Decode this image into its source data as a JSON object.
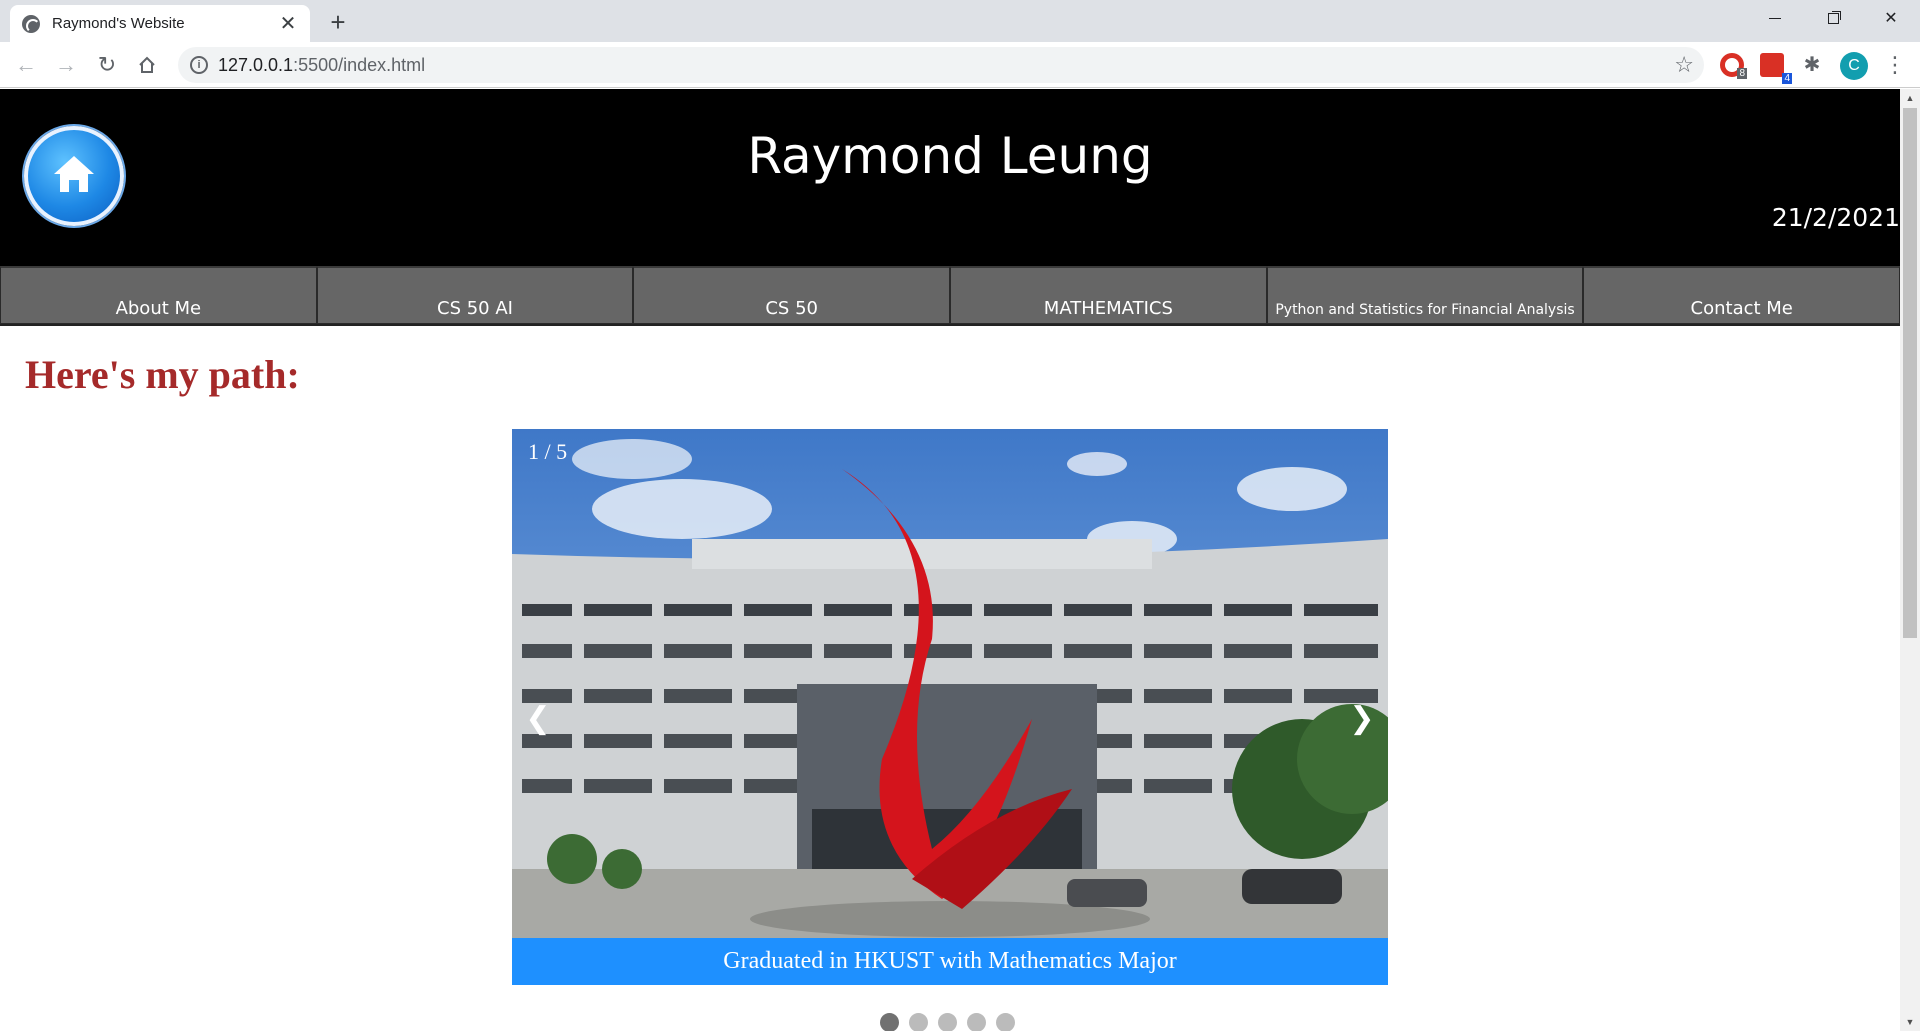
{
  "browser": {
    "tab_title": "Raymond's Website",
    "tab_close": "✕",
    "new_tab": "+",
    "url_host": "127.0.0.1",
    "url_rest": ":5500/index.html",
    "ext1_badge": "8",
    "ext2_badge": "4",
    "avatar_letter": "C"
  },
  "header": {
    "title": "Raymond Leung",
    "date": "21/2/2021"
  },
  "nav": {
    "items": [
      {
        "label": "About Me"
      },
      {
        "label": "CS 50 AI"
      },
      {
        "label": "CS 50"
      },
      {
        "label": "MATHEMATICS"
      },
      {
        "label": "Python and Statistics for Financial Analysis"
      },
      {
        "label": "Contact Me"
      }
    ]
  },
  "main": {
    "heading": "Here's my path:"
  },
  "slideshow": {
    "counter": "1 / 5",
    "prev": "❮",
    "next": "❯",
    "caption": "Graduated in HKUST with Mathematics Major",
    "total": 5,
    "active_index": 1
  },
  "colors": {
    "header_bg": "#000000",
    "nav_bg": "#666666",
    "heading": "#a52a2a",
    "caption_bg": "#1e90ff"
  }
}
